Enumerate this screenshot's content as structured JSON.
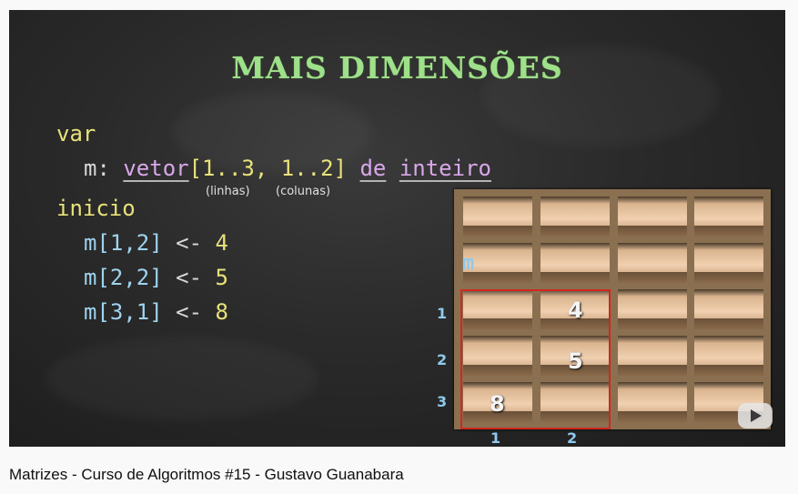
{
  "video": {
    "slide_title": "MAIS DIMENSÕES",
    "code": {
      "line_var": "var",
      "decl_name": "m:",
      "decl_type": "vetor",
      "decl_range1": "[1..3,",
      "decl_range2": "1..2]",
      "decl_de": "de",
      "decl_base": "inteiro",
      "annot_rows": "(linhas)",
      "annot_cols": "(colunas)",
      "line_inicio": "inicio",
      "assign": [
        {
          "target": "m[1,2]",
          "arrow": "<-",
          "value": "4"
        },
        {
          "target": "m[2,2]",
          "arrow": "<-",
          "value": "5"
        },
        {
          "target": "m[3,1]",
          "arrow": "<-",
          "value": "8"
        }
      ]
    },
    "matrix": {
      "label": "m",
      "row_indices": [
        "1",
        "2",
        "3"
      ],
      "col_indices": [
        "1",
        "2"
      ],
      "values": {
        "r1c2": "4",
        "r2c2": "5",
        "r3c1": "8"
      }
    }
  },
  "page": {
    "video_title": "Matrizes - Curso de Algoritmos #15 - Gustavo Guanabara"
  },
  "colors": {
    "highlight": "#d0271f",
    "title_green": "#9fe08a",
    "keyword": "#e8e27a"
  }
}
